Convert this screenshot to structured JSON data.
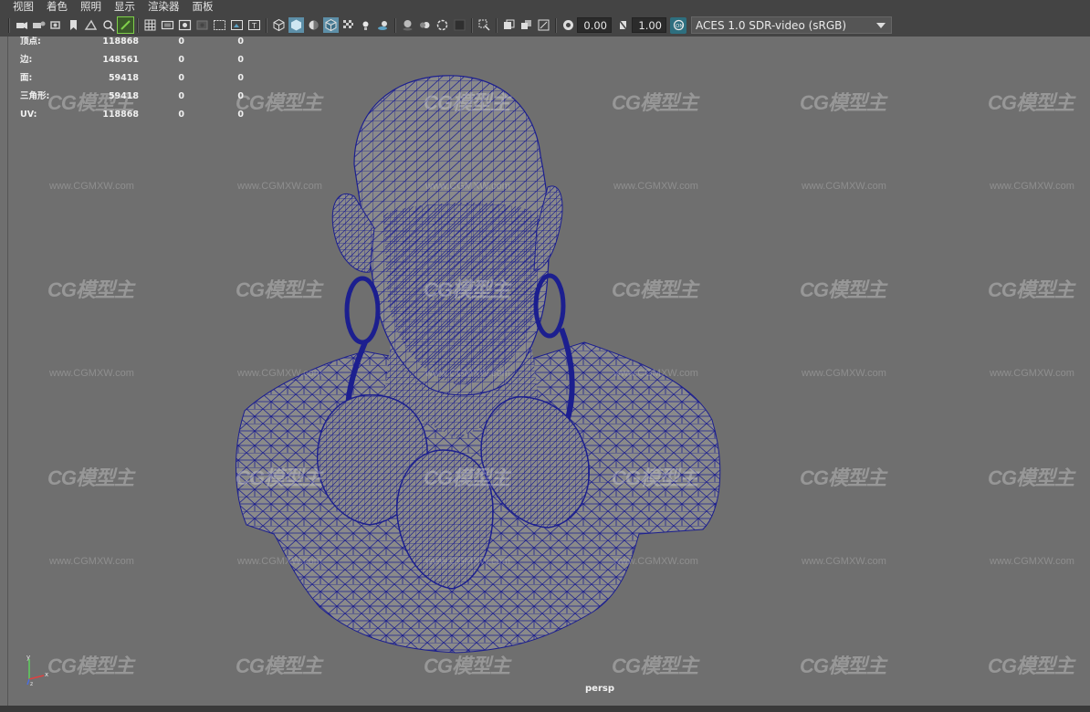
{
  "menu": [
    "视图",
    "着色",
    "照明",
    "显示",
    "渲染器",
    "面板"
  ],
  "toolbar": {
    "exposure_value": "0.00",
    "gamma_value": "1.00",
    "color_space": "ACES 1.0 SDR-video (sRGB)"
  },
  "hud": {
    "rows": [
      {
        "label": "顶点:",
        "v1": "118868",
        "v2": "0",
        "v3": "0"
      },
      {
        "label": "边:",
        "v1": "148561",
        "v2": "0",
        "v3": "0"
      },
      {
        "label": "面:",
        "v1": "59418",
        "v2": "0",
        "v3": "0"
      },
      {
        "label": "三角形:",
        "v1": "59418",
        "v2": "0",
        "v3": "0"
      },
      {
        "label": "UV:",
        "v1": "118868",
        "v2": "0",
        "v3": "0"
      }
    ]
  },
  "camera_label": "persp",
  "watermark": {
    "logo": "CG模型主",
    "url": "www.CGMXW.com"
  },
  "axis": {
    "y": "y",
    "x": "x",
    "z": "z"
  },
  "colors": {
    "wireframe": "#1c1f8f",
    "mesh_fill": "#8a8a8a",
    "viewport_bg": "#6f6f6f",
    "accent_active": "#7fd04a"
  }
}
